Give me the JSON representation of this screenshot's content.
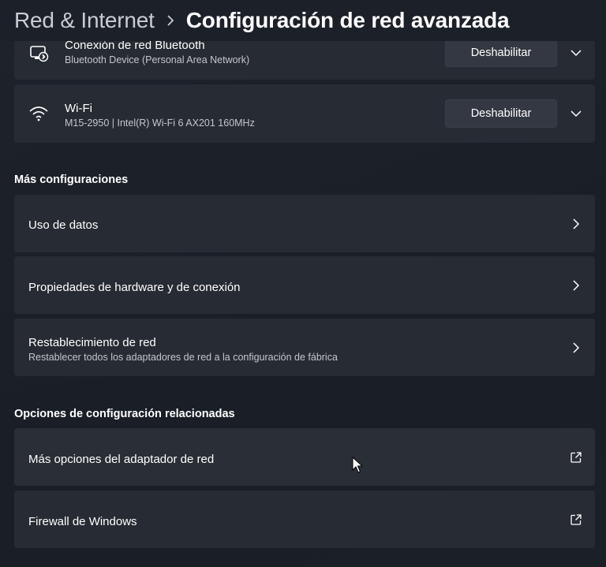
{
  "header": {
    "parent": "Red & Internet",
    "current": "Configuración de red avanzada"
  },
  "adapters": [
    {
      "icon": "ethernet-bluetooth-icon",
      "name": "Conexión de red Bluetooth",
      "description": "Bluetooth Device (Personal Area Network)",
      "button_label": "Deshabilitar"
    },
    {
      "icon": "wifi-icon",
      "name": "Wi-Fi",
      "description": "M15-2950 | Intel(R) Wi-Fi 6 AX201 160MHz",
      "button_label": "Deshabilitar"
    }
  ],
  "more_settings": {
    "title": "Más configuraciones",
    "items": [
      {
        "title": "Uso de datos"
      },
      {
        "title": "Propiedades de hardware y de conexión"
      },
      {
        "title": "Restablecimiento de red",
        "subtitle": "Restablecer todos los adaptadores de red a la configuración de fábrica"
      }
    ]
  },
  "related": {
    "title": "Opciones de configuración relacionadas",
    "items": [
      {
        "title": "Más opciones del adaptador de red",
        "icon": "external-link-icon"
      },
      {
        "title": "Firewall de Windows",
        "icon": "external-link-icon"
      }
    ]
  }
}
